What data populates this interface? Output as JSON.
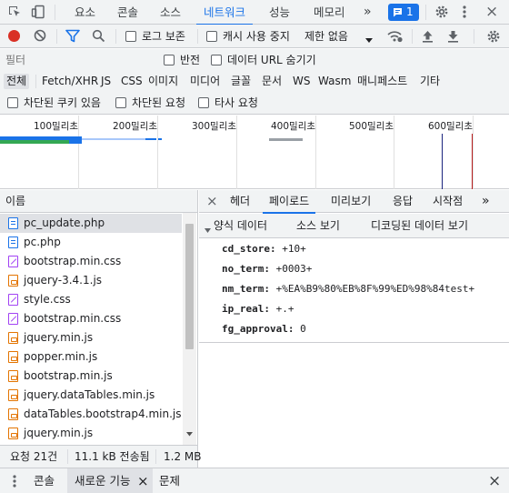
{
  "top_tabs": {
    "items": [
      "요소",
      "콘솔",
      "소스",
      "네트워크",
      "성능",
      "메모리"
    ],
    "active": "네트워크",
    "more": "»",
    "issues_count": "1"
  },
  "toolbar": {
    "disable_cache_label": "로그 보존",
    "cache_label": "캐시 사용 중지",
    "throttle_label": "제한 없음"
  },
  "filter": {
    "placeholder": "필터",
    "invert_label": "반전",
    "hide_data_urls_label": "데이터 URL 숨기기"
  },
  "type_filters": [
    "전체",
    "Fetch/XHR",
    "JS",
    "CSS",
    "이미지",
    "미디어",
    "글꼴",
    "문서",
    "WS",
    "Wasm",
    "매니페스트",
    "기타"
  ],
  "blocked": {
    "blocked_cookies_label": "차단된 쿠키 있음",
    "blocked_requests_label": "차단된 요청",
    "third_party_label": "타사 요청"
  },
  "overview": {
    "ticks": [
      "100밀리초",
      "200밀리초",
      "300밀리초",
      "400밀리초",
      "500밀리초",
      "600밀리초"
    ]
  },
  "request_list": {
    "header": "이름",
    "rows": [
      {
        "name": "pc_update.php",
        "type": "doc"
      },
      {
        "name": "pc.php",
        "type": "doc"
      },
      {
        "name": "bootstrap.min.css",
        "type": "css"
      },
      {
        "name": "jquery-3.4.1.js",
        "type": "js"
      },
      {
        "name": "style.css",
        "type": "css"
      },
      {
        "name": "bootstrap.min.css",
        "type": "css"
      },
      {
        "name": "jquery.min.js",
        "type": "js"
      },
      {
        "name": "popper.min.js",
        "type": "js"
      },
      {
        "name": "bootstrap.min.js",
        "type": "js"
      },
      {
        "name": "jquery.dataTables.min.js",
        "type": "js"
      },
      {
        "name": "dataTables.bootstrap4.min.js",
        "type": "js"
      },
      {
        "name": "jquery.min.js",
        "type": "js"
      }
    ]
  },
  "detail": {
    "close": "×",
    "tabs": [
      "헤더",
      "페이로드",
      "미리보기",
      "응답",
      "시작점"
    ],
    "active_tab": "페이로드",
    "more": "»",
    "section_title": "양식 데이터",
    "view_source": "소스 보기",
    "view_decoded": "디코딩된 데이터 보기",
    "form_data": [
      {
        "key": "cd_store:",
        "value": "+10+"
      },
      {
        "key": "no_term:",
        "value": "+0003+"
      },
      {
        "key": "nm_term:",
        "value": "+%EA%B9%80%EB%8F%99%ED%98%84test+"
      },
      {
        "key": "ip_real:",
        "value": "+.+"
      },
      {
        "key": "fg_approval:",
        "value": "0"
      }
    ]
  },
  "status": {
    "requests": "요청 21건",
    "transferred": "11.1 kB 전송됨",
    "resources": "1.2 MB"
  },
  "drawer": {
    "tabs": [
      "콘솔",
      "새로운 기능",
      "문제"
    ],
    "active_tab": "새로운 기능",
    "tab_close": "×",
    "close": "×"
  }
}
